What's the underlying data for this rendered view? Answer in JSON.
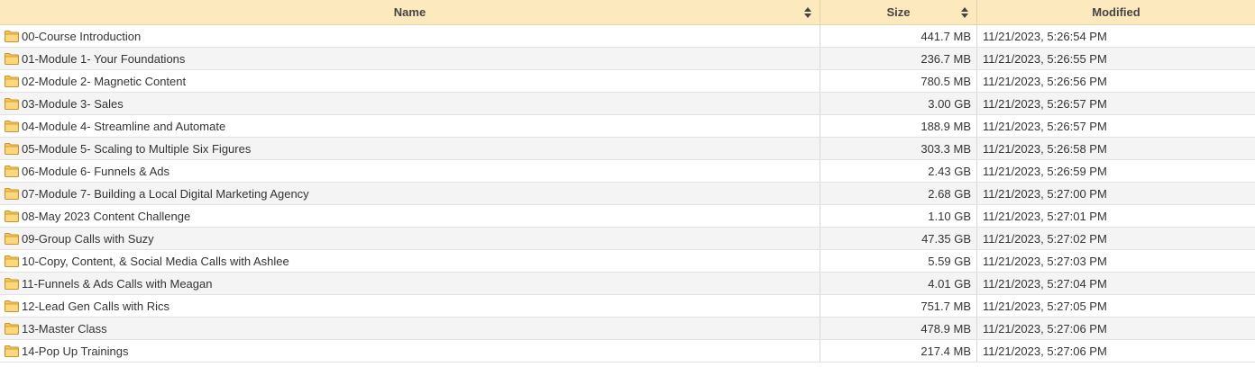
{
  "columns": {
    "name": "Name",
    "size": "Size",
    "modified": "Modified"
  },
  "icons": {
    "folder": "folder-icon",
    "sort": "sort-icon"
  },
  "colors": {
    "header_bg": "#fde9be",
    "folder_fill": "#f7c55b",
    "folder_stroke": "#c9952a"
  },
  "rows": [
    {
      "name": "00-Course Introduction",
      "size": "441.7 MB",
      "modified": "11/21/2023, 5:26:54 PM"
    },
    {
      "name": "01-Module 1- Your Foundations",
      "size": "236.7 MB",
      "modified": "11/21/2023, 5:26:55 PM"
    },
    {
      "name": "02-Module 2- Magnetic Content",
      "size": "780.5 MB",
      "modified": "11/21/2023, 5:26:56 PM"
    },
    {
      "name": "03-Module 3- Sales",
      "size": "3.00 GB",
      "modified": "11/21/2023, 5:26:57 PM"
    },
    {
      "name": "04-Module 4- Streamline and Automate",
      "size": "188.9 MB",
      "modified": "11/21/2023, 5:26:57 PM"
    },
    {
      "name": "05-Module 5- Scaling to Multiple Six Figures",
      "size": "303.3 MB",
      "modified": "11/21/2023, 5:26:58 PM"
    },
    {
      "name": "06-Module 6- Funnels & Ads",
      "size": "2.43 GB",
      "modified": "11/21/2023, 5:26:59 PM"
    },
    {
      "name": "07-Module 7- Building a Local Digital Marketing Agency",
      "size": "2.68 GB",
      "modified": "11/21/2023, 5:27:00 PM"
    },
    {
      "name": "08-May 2023 Content Challenge",
      "size": "1.10 GB",
      "modified": "11/21/2023, 5:27:01 PM"
    },
    {
      "name": "09-Group Calls with Suzy",
      "size": "47.35 GB",
      "modified": "11/21/2023, 5:27:02 PM"
    },
    {
      "name": "10-Copy, Content, & Social Media Calls with Ashlee",
      "size": "5.59 GB",
      "modified": "11/21/2023, 5:27:03 PM"
    },
    {
      "name": "11-Funnels & Ads Calls with Meagan",
      "size": "4.01 GB",
      "modified": "11/21/2023, 5:27:04 PM"
    },
    {
      "name": "12-Lead Gen Calls with Rics",
      "size": "751.7 MB",
      "modified": "11/21/2023, 5:27:05 PM"
    },
    {
      "name": "13-Master Class",
      "size": "478.9 MB",
      "modified": "11/21/2023, 5:27:06 PM"
    },
    {
      "name": "14-Pop Up Trainings",
      "size": "217.4 MB",
      "modified": "11/21/2023, 5:27:06 PM"
    }
  ]
}
